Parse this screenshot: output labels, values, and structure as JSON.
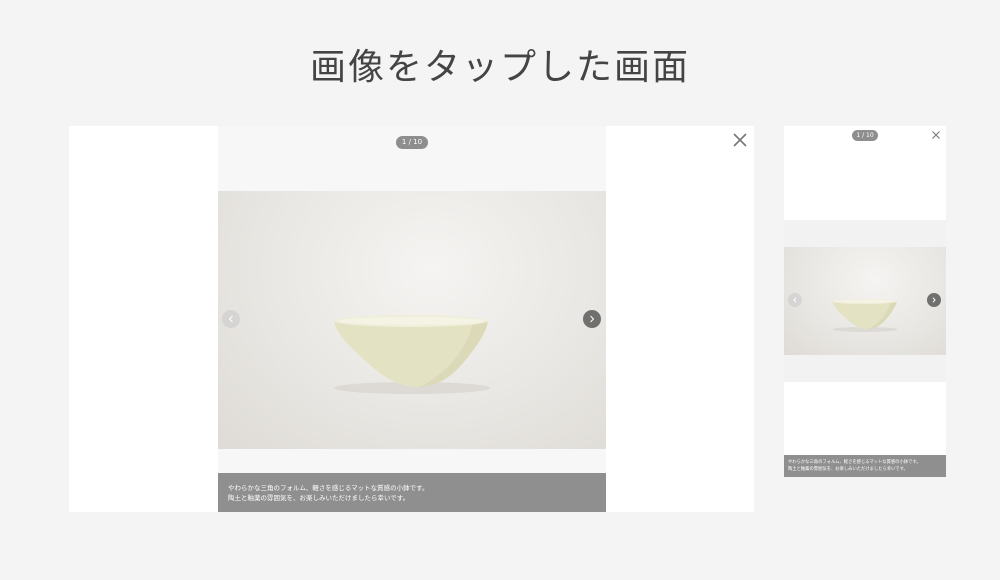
{
  "page": {
    "title": "画像をタップした画面"
  },
  "desktop_viewer": {
    "counter": "1 / 10",
    "caption": {
      "line1": "やわらかな三角のフォルム、軽さを感じるマットな質感の小鉢です。",
      "line2": "陶土と釉薬の雰囲気を、お楽しみいただけましたら幸いです。"
    },
    "icons": {
      "close": "close-icon",
      "prev": "chevron-left-icon",
      "next": "chevron-right-icon"
    }
  },
  "mobile_viewer": {
    "counter": "1 / 10",
    "caption": {
      "line1": "やわらかな三角のフォルム、軽さを感じるマットな質感の小鉢です。",
      "line2": "陶土と釉薬の雰囲気を、お楽しみいただけましたら幸いです。"
    },
    "icons": {
      "close": "close-icon",
      "prev": "chevron-left-icon",
      "next": "chevron-right-icon"
    }
  },
  "colors": {
    "background": "#f4f4f4",
    "counter_badge": "#8e8e8e",
    "caption_bar": "#8f8f8f",
    "bowl_glaze": "#e8e7c9"
  }
}
